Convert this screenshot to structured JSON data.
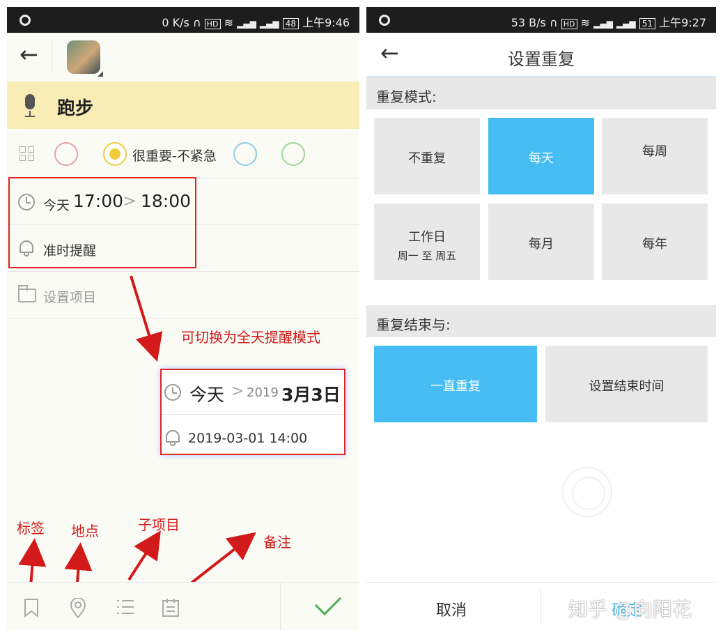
{
  "left": {
    "status": {
      "speed": "0 K/s",
      "battery": "48",
      "time": "上午9:46"
    },
    "task": {
      "title": "跑步"
    },
    "priority": {
      "selected_label": "很重要-不紧急",
      "colors": [
        "#e8a2a2",
        "#f0cd3b",
        "#8fcbe8",
        "#9ed69a"
      ]
    },
    "time_row": {
      "day": "今天",
      "start": "17:00",
      "end": "18:00"
    },
    "reminder": {
      "label": "准时提醒"
    },
    "project": {
      "placeholder": "设置项目"
    },
    "popup": {
      "day": "今天",
      "year": "2019",
      "date": "3月3日",
      "reminder": "2019-03-01 14:00"
    },
    "annotations": {
      "switch_mode": "可切换为全天提醒模式",
      "tag": "标签",
      "location": "地点",
      "subitem": "子项目",
      "note": "备注"
    }
  },
  "right": {
    "status": {
      "speed": "53 B/s",
      "battery": "51",
      "time": "上午9:27"
    },
    "title": "设置重复",
    "mode_header": "重复模式:",
    "modes": [
      {
        "label": "不重复",
        "sub": "",
        "selected": false
      },
      {
        "label": "每天",
        "sub": "",
        "selected": true
      },
      {
        "label": "每周",
        "sub": "",
        "selected": false
      },
      {
        "label": "工作日",
        "sub": "周一 至 周五",
        "selected": false
      },
      {
        "label": "每月",
        "sub": "",
        "selected": false
      },
      {
        "label": "每年",
        "sub": "",
        "selected": false
      }
    ],
    "end_header": "重复结束与:",
    "end_options": [
      {
        "label": "一直重复",
        "selected": true
      },
      {
        "label": "设置结束时间",
        "selected": false
      }
    ],
    "cancel": "取消",
    "confirm": "确定",
    "watermark": "知乎 @向阳花"
  },
  "colors": {
    "accent": "#45bdf2",
    "annotation_red": "#d21a1a",
    "title_bg": "#f8edb4",
    "check_green": "#4caf50"
  }
}
